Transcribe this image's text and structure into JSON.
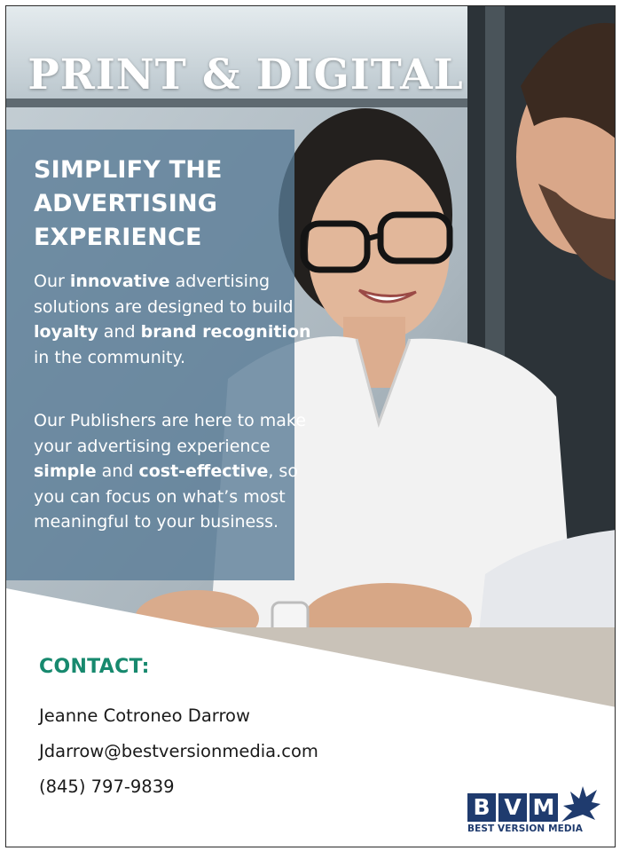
{
  "ad": {
    "headline": "PRINT & DIGITAL",
    "panel": {
      "title_lines": [
        "SIMPLIFY THE",
        "ADVERTISING",
        "EXPERIENCE"
      ],
      "paragraph1": {
        "t1": "Our ",
        "b1": "innovative",
        "t2": " advertising solutions are designed to build ",
        "b2": "loyalty",
        "t3": " and ",
        "b3": "brand recognition",
        "t4": " in the community."
      },
      "paragraph2": {
        "t1": "Our Publishers are here to make your advertising experience ",
        "b1": "simple",
        "t2": " and ",
        "b2": "cost-effective",
        "t3": ", so you can focus on what’s most meaningful to your business."
      }
    },
    "contact": {
      "label": "CONTACT:",
      "name": "Jeanne Cotroneo Darrow",
      "email": "Jdarrow@bestversionmedia.com",
      "phone": "(845) 797-9839"
    },
    "logo": {
      "letters": [
        "B",
        "V",
        "M"
      ],
      "caption": "BEST VERSION MEDIA"
    },
    "colors": {
      "panel": "#587b96",
      "contact_accent": "#17896e",
      "logo_navy": "#1f3b6e"
    }
  }
}
